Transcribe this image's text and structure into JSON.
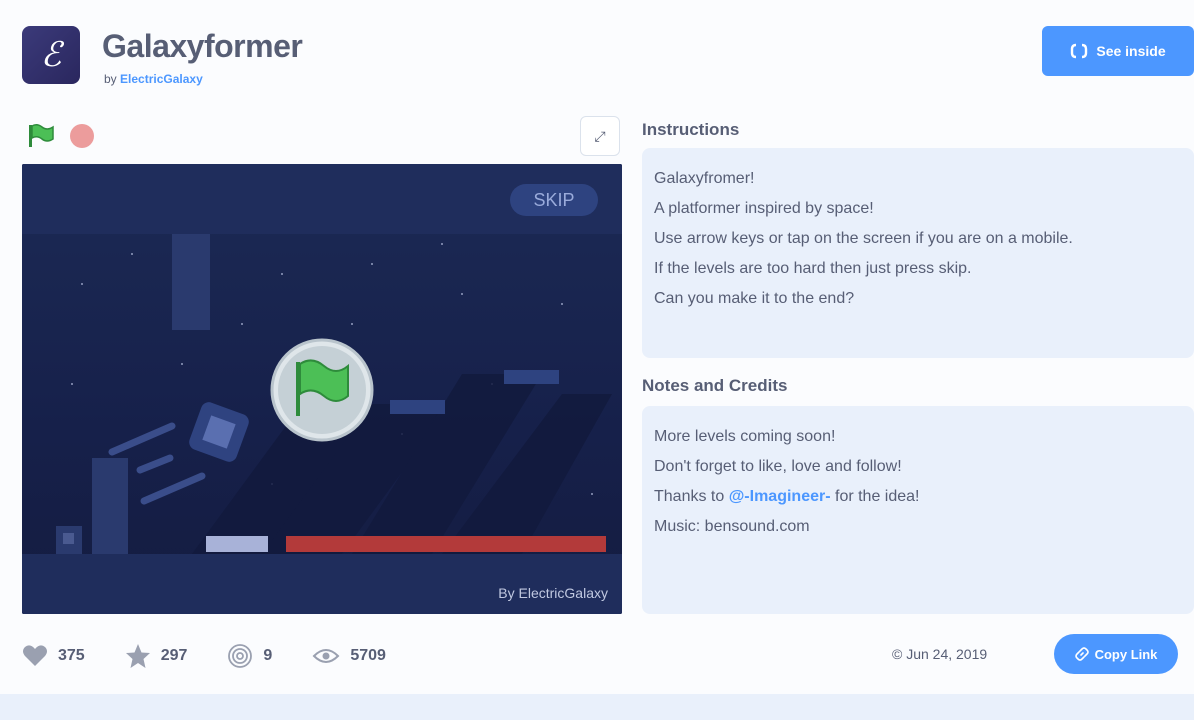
{
  "project": {
    "title": "Galaxyformer",
    "by_prefix": "by",
    "author": "ElectricGalaxy",
    "avatar_glyph": "ℰ"
  },
  "header": {
    "see_inside_label": "See inside",
    "see_inside_icon": "code-brackets-icon"
  },
  "player": {
    "green_flag_icon": "green-flag-icon",
    "stop_icon": "stop-icon",
    "fullscreen_icon": "fullscreen-icon",
    "fullscreen_glyph": "⤢",
    "skip_label": "SKIP",
    "watermark": "By ElectricGalaxy"
  },
  "instructions": {
    "title": "Instructions",
    "lines": [
      "Galaxyfromer!",
      "A platformer inspired by space!",
      "Use arrow keys or tap on the screen if you are on a mobile.",
      "If the levels are too hard then just press skip.",
      "Can you make it to the end?"
    ]
  },
  "notes": {
    "title": "Notes and Credits",
    "line1": "More levels coming soon!",
    "line2": "Don't forget to like, love and follow!",
    "line3_prefix": "Thanks to ",
    "line3_mention": "@-Imagineer-",
    "line3_suffix": " for the idea!",
    "line4": "Music: bensound.com"
  },
  "stats": {
    "loves": "375",
    "favorites": "297",
    "remixes": "9",
    "views": "5709"
  },
  "footer": {
    "date": "© Jun 24, 2019",
    "copy_link_label": "Copy Link"
  },
  "colors": {
    "accent": "#4c97ff",
    "text": "#575e75",
    "panel": "#e9f0fb",
    "stage_bg": "#1a2347",
    "lava": "#b33a3a"
  }
}
